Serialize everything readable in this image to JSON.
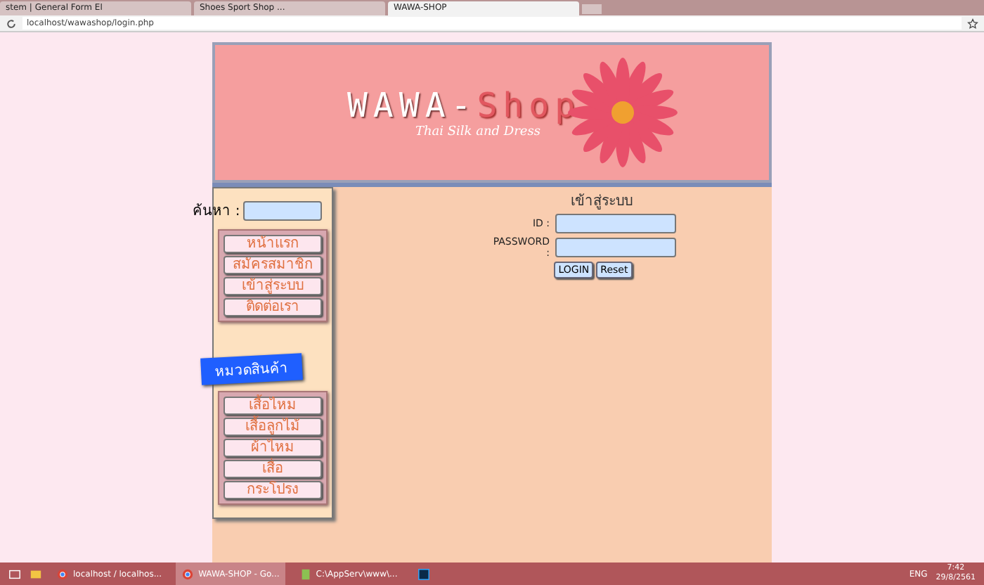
{
  "browser": {
    "tabs": [
      {
        "title": "stem | General Form El",
        "selected": false
      },
      {
        "title": "Shoes Sport Shop ...",
        "selected": false
      },
      {
        "title": "WAWA-SHOP",
        "selected": true
      }
    ],
    "address": "localhost/wawashop/login.php"
  },
  "banner": {
    "title_white": "WAWA-",
    "title_pink": "Shop",
    "tagline": "Thai Silk and Dress"
  },
  "sidebar": {
    "search_label": "ค้นหา :",
    "menu": [
      "หน้าแรก",
      "สมัครสมาชิก",
      "เข้าสู่ระบบ",
      "ติดต่อเรา"
    ],
    "category_label": "หมวดสินค้า",
    "categories": [
      "เสื้อไหม",
      "เสื้อลูกไม้",
      "ผ้าไหม",
      "เสื่อ",
      "กระโปรง"
    ]
  },
  "login": {
    "heading": "เข้าสู่ระบบ",
    "id_label": "ID :",
    "password_label": "PASSWORD :",
    "buttons": [
      "LOGIN",
      "Reset"
    ]
  },
  "taskbar": {
    "items": [
      {
        "label": "localhost / localhos...",
        "kind": "browser",
        "selected": false
      },
      {
        "label": "WAWA-SHOP - Go...",
        "kind": "browser",
        "selected": true
      },
      {
        "label": "C:\\AppServ\\www\\...",
        "kind": "editor",
        "selected": false
      },
      {
        "kind": "photoshop",
        "selected": false
      }
    ],
    "language": "ENG",
    "time": "7:42",
    "date": "29/8/2561"
  }
}
